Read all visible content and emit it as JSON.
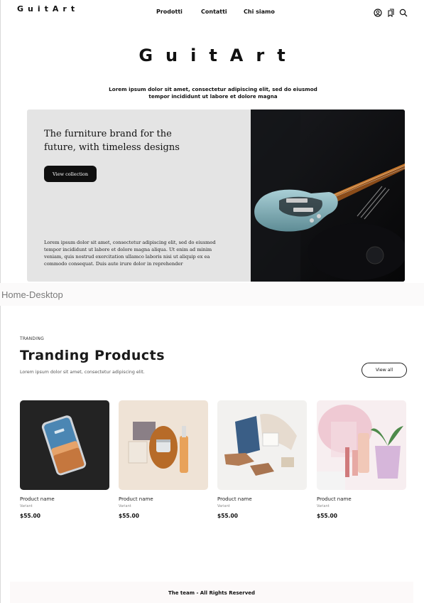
{
  "nav": {
    "logo": "GuitArt",
    "links": [
      "Prodotti",
      "Contatti",
      "Chi siamo"
    ],
    "icons": [
      "user-icon",
      "bookmarks-icon",
      "search-icon"
    ]
  },
  "brand": {
    "logo": "GuitArt",
    "tagline": "Lorem ipsum dolor sit amet, consectetur adipiscing elit, sed do eiusmod tempor incididunt ut labore et dolore magna"
  },
  "hero": {
    "title": "The furniture brand for the future, with timeless designs",
    "button_label": "View collection",
    "body": "Lorem ipsum dolor sit amet, consectetur adipiscing elit, sed do eiusmod tempor incididunt ut labore et dolore magna aliqua. Ut enim ad minim veniam, quis nostrud exercitation ullamco laboris nisi ut aliquip ex ea commodo consequat. Duis aute irure dolor in reprehender"
  },
  "frame_label": "Home-Desktop",
  "trending": {
    "kicker": "TRANDING",
    "title": "Tranding Products",
    "subtitle": "Lorem ipsum dolor sit amet, consectetur adipiscing elit.",
    "view_all_label": "View all",
    "products": [
      {
        "name": "Product name",
        "variant": "Variant",
        "price": "$55.00",
        "image": "smartphone"
      },
      {
        "name": "Product name",
        "variant": "Variant",
        "price": "$55.00",
        "image": "skincare"
      },
      {
        "name": "Product name",
        "variant": "Variant",
        "price": "$55.00",
        "image": "clothing"
      },
      {
        "name": "Product name",
        "variant": "Variant",
        "price": "$55.00",
        "image": "cosmetics"
      }
    ]
  },
  "footer": {
    "text": "The team - All Rights Reserved"
  }
}
